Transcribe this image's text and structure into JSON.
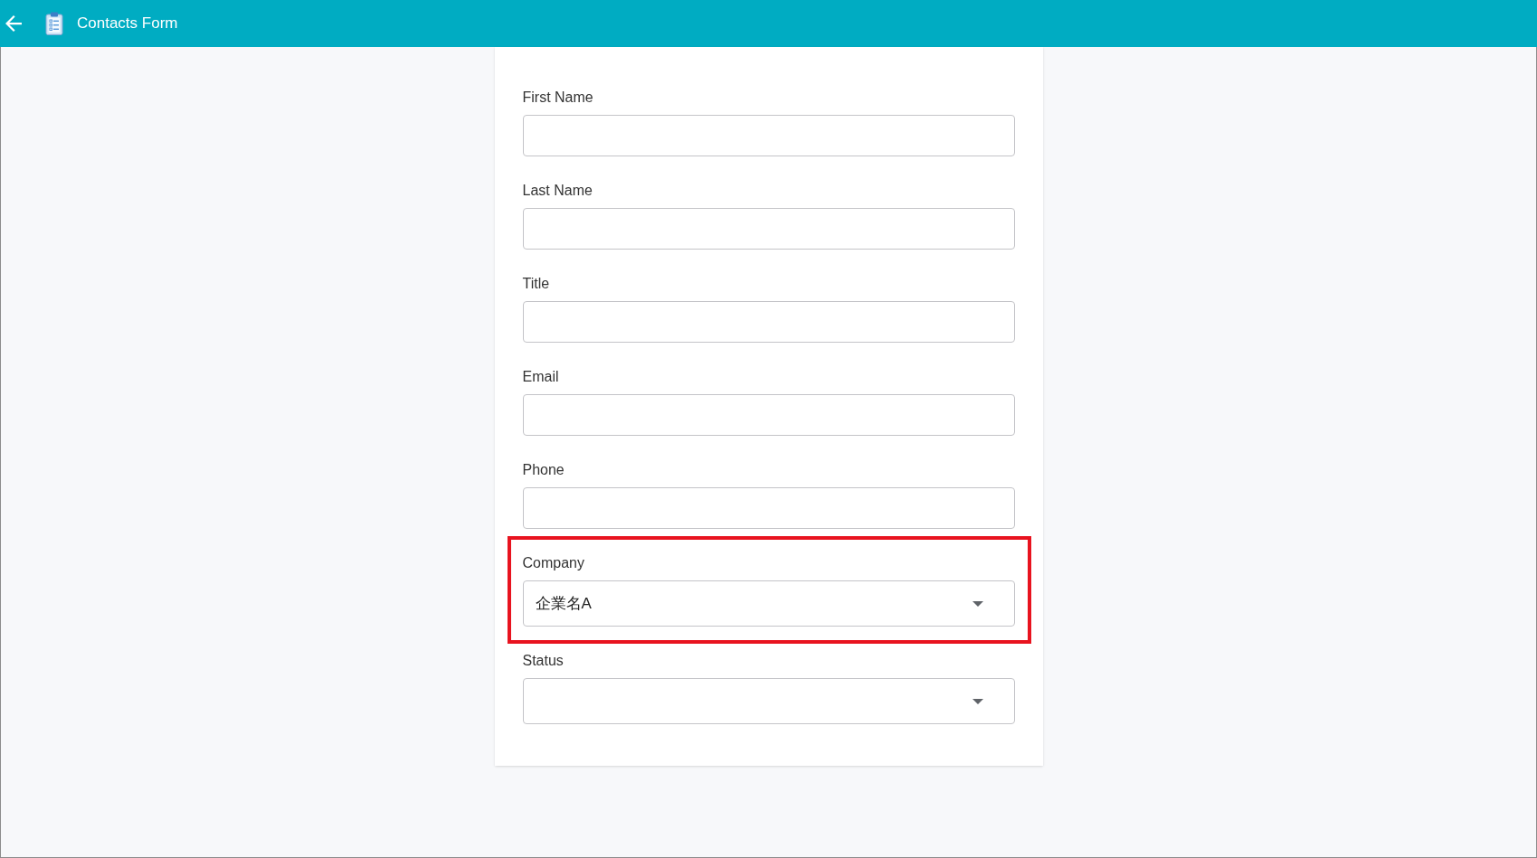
{
  "header": {
    "title": "Contacts Form"
  },
  "fields": [
    {
      "kind": "text",
      "label": "First Name",
      "highlighted": false
    },
    {
      "kind": "text",
      "label": "Last Name",
      "highlighted": false
    },
    {
      "kind": "text",
      "label": "Title",
      "highlighted": false
    },
    {
      "kind": "text",
      "label": "Email",
      "highlighted": false
    },
    {
      "kind": "text",
      "label": "Phone",
      "highlighted": false
    },
    {
      "kind": "select",
      "label": "Company",
      "value": "企業名A",
      "highlighted": true
    },
    {
      "kind": "select",
      "label": "Status",
      "highlighted": false
    }
  ]
}
